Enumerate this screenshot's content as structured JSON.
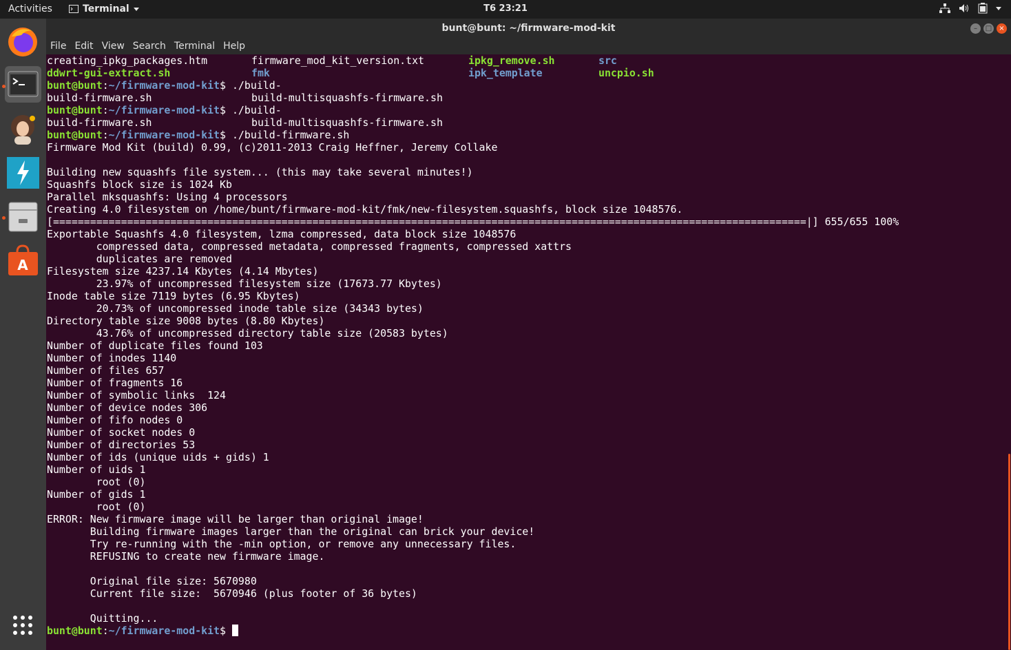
{
  "topbar": {
    "activities": "Activities",
    "app_name": "Terminal",
    "clock": "T6 23:21"
  },
  "window": {
    "title": "bunt@bunt: ~/firmware-mod-kit"
  },
  "menu": [
    "File",
    "Edit",
    "View",
    "Search",
    "Terminal",
    "Help"
  ],
  "dock": [
    {
      "name": "firefox-icon"
    },
    {
      "name": "terminal-icon",
      "active": true
    },
    {
      "name": "avatar-app-icon"
    },
    {
      "name": "lightning-app-icon"
    },
    {
      "name": "file-manager-icon"
    },
    {
      "name": "software-center-icon"
    },
    {
      "name": "show-applications-icon"
    }
  ],
  "prompt": {
    "user": "bunt@bunt",
    "path": "~/firmware-mod-kit",
    "symbol": "$ "
  },
  "ls_row1": {
    "c1": "creating_ipkg_packages.htm",
    "c2": "firmware_mod_kit_version.txt",
    "c3": "ipkg_remove.sh",
    "c4": "src"
  },
  "ls_row2": {
    "c1": "ddwrt-gui-extract.sh",
    "c2": "fmk",
    "c3": "ipk_template",
    "c4": "uncpio.sh"
  },
  "cmd_partial": "./build-",
  "cmd_full": "./build-firmware.sh",
  "completion": {
    "c1": "build-firmware.sh",
    "c2": "build-multisquashfs-firmware.sh"
  },
  "output": [
    "Firmware Mod Kit (build) 0.99, (c)2011-2013 Craig Heffner, Jeremy Collake",
    "",
    "Building new squashfs file system... (this may take several minutes!)",
    "Squashfs block size is 1024 Kb",
    "Parallel mksquashfs: Using 4 processors",
    "Creating 4.0 filesystem on /home/bunt/firmware-mod-kit/fmk/new-filesystem.squashfs, block size 1048576.",
    "[==========================================================================================================================|] 655/655 100%",
    "Exportable Squashfs 4.0 filesystem, lzma compressed, data block size 1048576",
    "        compressed data, compressed metadata, compressed fragments, compressed xattrs",
    "        duplicates are removed",
    "Filesystem size 4237.14 Kbytes (4.14 Mbytes)",
    "        23.97% of uncompressed filesystem size (17673.77 Kbytes)",
    "Inode table size 7119 bytes (6.95 Kbytes)",
    "        20.73% of uncompressed inode table size (34343 bytes)",
    "Directory table size 9008 bytes (8.80 Kbytes)",
    "        43.76% of uncompressed directory table size (20583 bytes)",
    "Number of duplicate files found 103",
    "Number of inodes 1140",
    "Number of files 657",
    "Number of fragments 16",
    "Number of symbolic links  124",
    "Number of device nodes 306",
    "Number of fifo nodes 0",
    "Number of socket nodes 0",
    "Number of directories 53",
    "Number of ids (unique uids + gids) 1",
    "Number of uids 1",
    "        root (0)",
    "Number of gids 1",
    "        root (0)",
    "ERROR: New firmware image will be larger than original image!",
    "       Building firmware images larger than the original can brick your device!",
    "       Try re-running with the -min option, or remove any unnecessary files.",
    "       REFUSING to create new firmware image.",
    "",
    "       Original file size: 5670980",
    "       Current file size:  5670946 (plus footer of 36 bytes)",
    "",
    "       Quitting..."
  ]
}
